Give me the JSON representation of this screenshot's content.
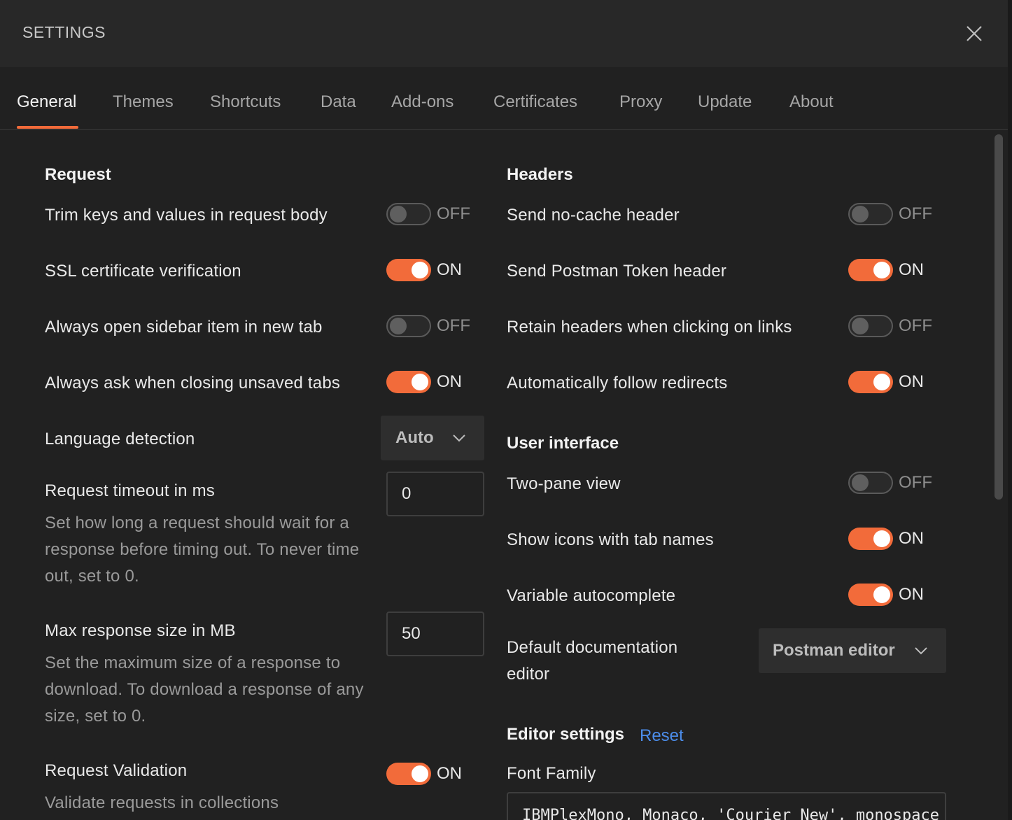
{
  "window": {
    "title": "SETTINGS"
  },
  "tabs": [
    {
      "label": "General"
    },
    {
      "label": "Themes"
    },
    {
      "label": "Shortcuts"
    },
    {
      "label": "Data"
    },
    {
      "label": "Add-ons"
    },
    {
      "label": "Certificates"
    },
    {
      "label": "Proxy"
    },
    {
      "label": "Update"
    },
    {
      "label": "About"
    }
  ],
  "active_tab": "General",
  "colors": {
    "accent": "#f26b3a",
    "link": "#4c8dea",
    "background": "#212121"
  },
  "request": {
    "heading": "Request",
    "trim_keys": {
      "label": "Trim keys and values in request body",
      "state": "OFF"
    },
    "ssl_verification": {
      "label": "SSL certificate verification",
      "state": "ON"
    },
    "open_sidebar_new_tab": {
      "label": "Always open sidebar item in new tab",
      "state": "OFF"
    },
    "ask_closing_unsaved": {
      "label": "Always ask when closing unsaved tabs",
      "state": "ON"
    },
    "language_detection": {
      "label": "Language detection",
      "value": "Auto"
    },
    "timeout": {
      "label": "Request timeout in ms",
      "value": "0",
      "description": "Set how long a request should wait for a response before timing out. To never time out, set to 0."
    },
    "max_response": {
      "label": "Max response size in MB",
      "value": "50",
      "description": "Set the maximum size of a response to download. To download a response of any size, set to 0."
    },
    "validation": {
      "label": "Request Validation",
      "state": "ON",
      "description": "Validate requests in collections"
    }
  },
  "headers": {
    "heading": "Headers",
    "no_cache": {
      "label": "Send no-cache header",
      "state": "OFF"
    },
    "postman_token": {
      "label": "Send Postman Token header",
      "state": "ON"
    },
    "retain_headers": {
      "label": "Retain headers when clicking on links",
      "state": "OFF"
    },
    "follow_redirects": {
      "label": "Automatically follow redirects",
      "state": "ON"
    }
  },
  "user_interface": {
    "heading": "User interface",
    "two_pane": {
      "label": "Two-pane view",
      "state": "OFF"
    },
    "tab_icons": {
      "label": "Show icons with tab names",
      "state": "ON"
    },
    "variable_autocomplete": {
      "label": "Variable autocomplete",
      "state": "ON"
    },
    "doc_editor": {
      "label": "Default documentation editor",
      "value": "Postman editor"
    }
  },
  "editor_settings": {
    "heading": "Editor settings",
    "reset_label": "Reset",
    "font_family": {
      "label": "Font Family",
      "value": "IBMPlexMono, Monaco, 'Courier New', monospace"
    }
  }
}
